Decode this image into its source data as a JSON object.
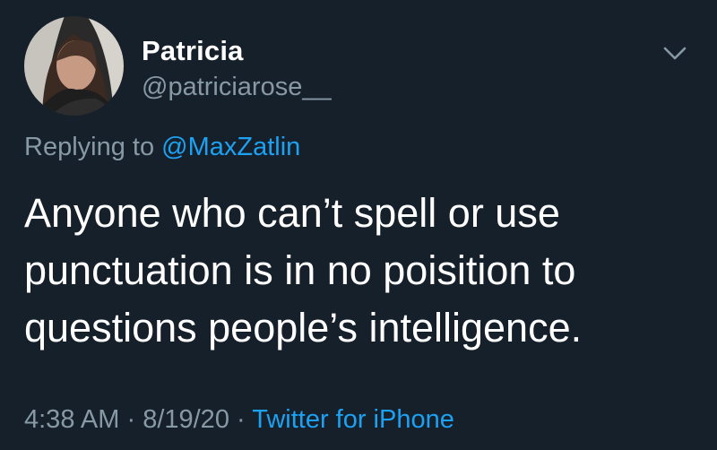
{
  "tweet": {
    "display_name": "Patricia",
    "handle": "@patriciarose__",
    "reply_prefix": "Replying to ",
    "reply_to": "@MaxZatlin",
    "text_lines": [
      "Anyone who can’t spell or use",
      "punctuation is in no poisition to",
      "questions people’s intelligence."
    ],
    "time": "4:38 AM",
    "separator": " · ",
    "date": "8/19/20",
    "source": "Twitter for iPhone"
  },
  "colors": {
    "background": "#15202b",
    "primary_text": "#ffffff",
    "secondary_text": "#8899a6",
    "link": "#1da1f2"
  },
  "icons": {
    "menu": "chevron-down-icon"
  }
}
